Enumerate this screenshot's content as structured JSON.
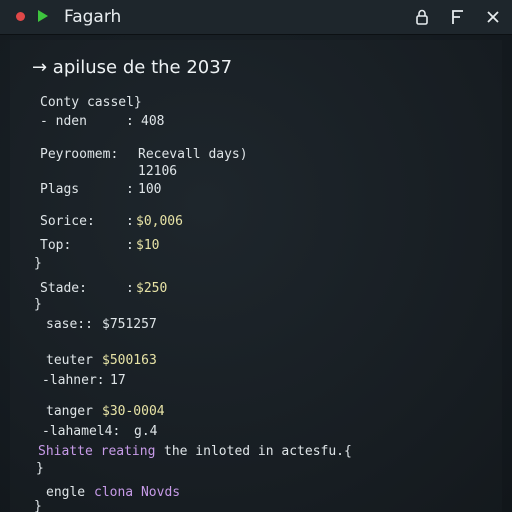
{
  "window": {
    "title": "Fagarh",
    "icons": [
      "close-dot-icon",
      "play-icon",
      "lock-icon",
      "flag-icon",
      "close-icon"
    ],
    "colors": {
      "red": "#e04848",
      "green": "#3ec43e",
      "yellow": "#e7e3a6",
      "purple": "#c79be8"
    }
  },
  "terminal": {
    "prompt": "→ apiluse de the 2037",
    "lines": [
      {
        "key": "Conty cassel}",
        "sep": "",
        "value": ""
      },
      {
        "key": "- nden",
        "sep": ":",
        "value": "408"
      },
      {
        "key": "Peyroomem:",
        "sep": "",
        "value": "Recevall days)"
      },
      {
        "key": "",
        "sep": "",
        "value": "12106"
      },
      {
        "key": "Plags",
        "sep": ":",
        "value": "100"
      },
      {
        "key": "Sorice:",
        "sep": ":",
        "value": "$0,006"
      },
      {
        "key": "Top:",
        "sep": ":",
        "value": "$10"
      },
      {
        "key": "}",
        "sep": "",
        "value": ""
      },
      {
        "key": "Stade:",
        "sep": ":",
        "value": "$250"
      },
      {
        "key": "}",
        "sep": "",
        "value": ""
      },
      {
        "key": "sase::",
        "sep": "",
        "value": "$751257"
      },
      {
        "key": "teuter",
        "sep": "",
        "value": "$500163"
      },
      {
        "key": "-lahner:",
        "sep": "",
        "value": "17"
      },
      {
        "key": "tanger",
        "sep": "",
        "value": "$30-0004"
      },
      {
        "key": "-lahamel4:",
        "sep": "",
        "value": "g.4"
      },
      {
        "key": "Shiatte reating",
        "sep": "",
        "value": "the inloted in actesfu.{"
      },
      {
        "key": "}",
        "sep": "",
        "value": ""
      },
      {
        "key": "engle",
        "sep": "",
        "value": "clona Novds"
      },
      {
        "key": "}",
        "sep": "",
        "value": ""
      }
    ]
  }
}
